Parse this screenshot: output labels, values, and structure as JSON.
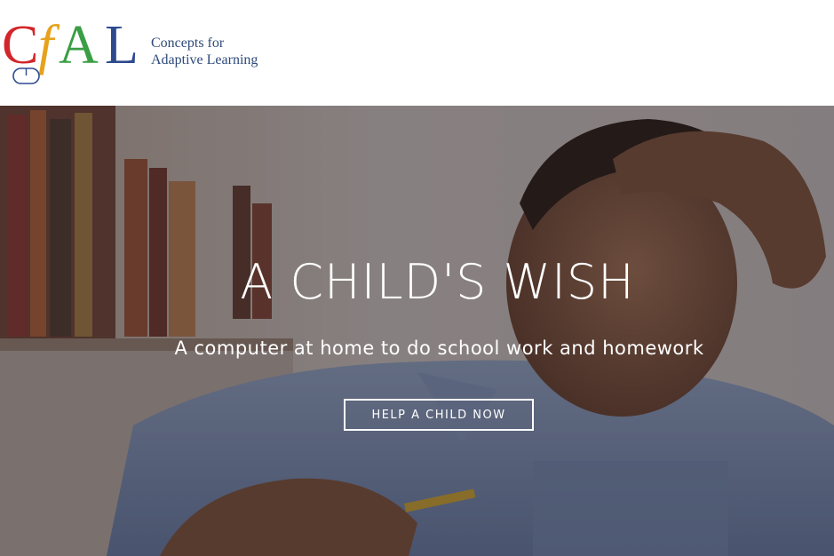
{
  "logo": {
    "letters": [
      "C",
      "f",
      "A",
      "L"
    ],
    "letter_colors": [
      "#d3262a",
      "#e6a21c",
      "#3a9e44",
      "#2e4a8f"
    ],
    "line1": "Concepts for",
    "line2": "Adaptive Learning",
    "icon": "computer-mouse-icon"
  },
  "hero": {
    "title": "A CHILD'S WISH",
    "subtitle": "A computer at home to do school work and homework",
    "cta_label": "HELP A CHILD NOW",
    "background_subject": "boy-studying-at-desk"
  }
}
